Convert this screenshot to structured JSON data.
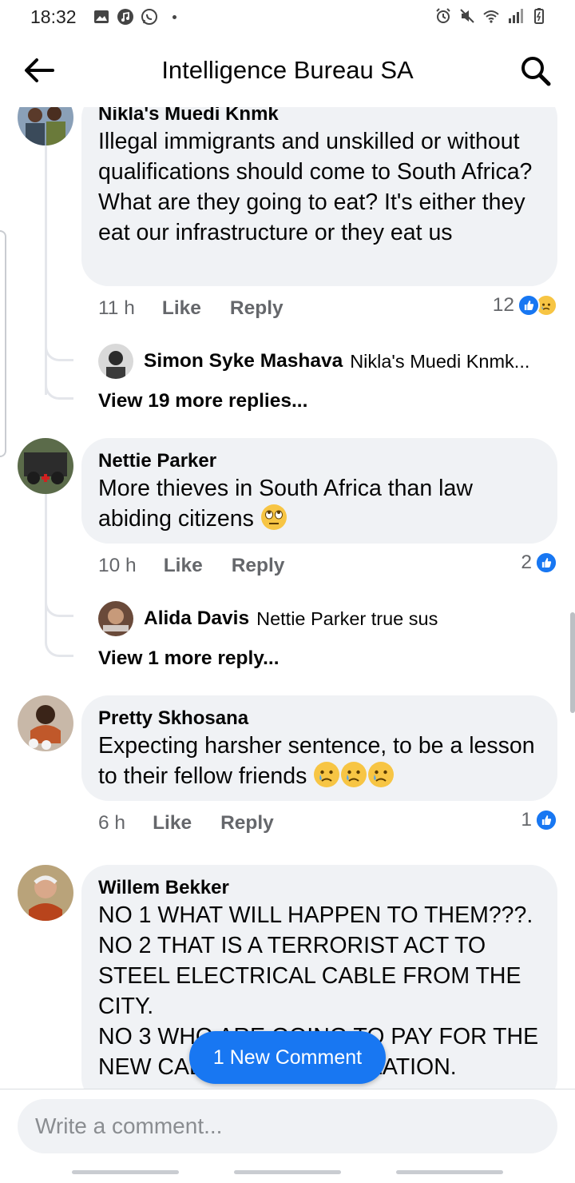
{
  "status_bar": {
    "time": "18:32",
    "left_icons": [
      "image-icon",
      "music-icon",
      "whatsapp-icon"
    ],
    "right_icons": [
      "alarm-icon",
      "mute-icon",
      "wifi-icon",
      "signal-icon",
      "battery-icon"
    ]
  },
  "header": {
    "title": "Intelligence Bureau SA",
    "back_icon": "back-arrow-icon",
    "search_icon": "search-icon"
  },
  "comments": [
    {
      "author": "Nikla's Muedi Knmk",
      "text": "Illegal immigrants and unskilled or without qualifications should come to South Africa? What are they going to eat? It's either they eat our infrastructure or they eat us",
      "time": "11 h",
      "like_label": "Like",
      "reply_label": "Reply",
      "reaction_count": "12",
      "reactions": [
        "like",
        "sad"
      ],
      "reply_preview": {
        "author": "Simon Syke Mashava",
        "text": "Nikla's Muedi Knmk..."
      },
      "view_more": "View 19 more replies..."
    },
    {
      "author": "Nettie Parker",
      "text": "More thieves  in South Africa  than law abiding  citizens",
      "time": "10 h",
      "like_label": "Like",
      "reply_label": "Reply",
      "reaction_count": "2",
      "reactions": [
        "like"
      ],
      "reply_preview": {
        "author": "Alida Davis",
        "text": "Nettie Parker true sus"
      },
      "view_more": "View 1 more reply..."
    },
    {
      "author": "Pretty Skhosana",
      "text": "Expecting harsher sentence, to be a lesson to their fellow friends",
      "time": "6 h",
      "like_label": "Like",
      "reply_label": "Reply",
      "reaction_count": "1",
      "reactions": [
        "like"
      ]
    },
    {
      "author": "Willem Bekker",
      "lines": [
        "NO 1 WHAT WILL HAPPEN TO THEM???.",
        "NO 2 THAT IS A TERRORIST ACT TO",
        "STEEL ELECTRICAL CABLE FROM THE",
        "CITY.",
        "NO 3 WHO ARE GOING TO PAY FOR THE",
        "NEW CABLE AND INSTALLATION."
      ]
    }
  ],
  "new_comment_pill": "1 New Comment",
  "composer": {
    "placeholder": "Write a comment..."
  },
  "colors": {
    "accent": "#1877f2",
    "bubble": "#f0f2f5",
    "meta_text": "#65676b"
  }
}
